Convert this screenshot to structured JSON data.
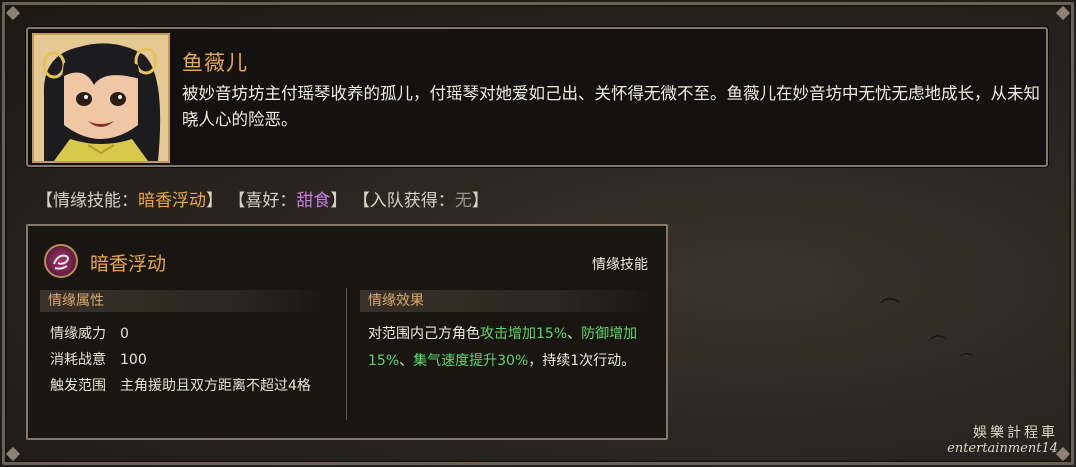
{
  "character": {
    "name": "鱼薇儿",
    "description": "被妙音坊坊主付瑶琴收养的孤儿，付瑶琴对她爱如己出、关怀得无微不至。鱼薇儿在妙音坊中无忧无虑地成长，从未知晓人心的险恶。"
  },
  "tags": {
    "skill_label": "【情缘技能：",
    "skill_value": "暗香浮动",
    "close1": "】",
    "hobby_label": "【喜好：",
    "hobby_value": "甜食",
    "close2": "】",
    "join_label": "【入队获得：",
    "join_value": "无",
    "close3": "】"
  },
  "skill": {
    "name": "暗香浮动",
    "type": "情缘技能",
    "attributes_header": "情缘属性",
    "effects_header": "情缘效果",
    "attributes": [
      {
        "label": "情缘威力",
        "value": "0"
      },
      {
        "label": "消耗战意",
        "value": "100"
      },
      {
        "label": "触发范围",
        "value": "主角援助且双方距离不超过4格"
      }
    ],
    "effect": {
      "p1": "对范围内己方角色",
      "g1": "攻击增加15%",
      "p2": "、",
      "g2": "防御增加15%",
      "p3": "、",
      "g3": "集气速度提升30%",
      "p4": "，持续1次行动。"
    }
  },
  "watermark": {
    "cn": "娛樂計程車",
    "en": "entertainment14"
  },
  "colors": {
    "accent_orange": "#e8a847",
    "hobby_purple": "#c57cd8",
    "buff_green": "#5ed66a",
    "frame": "#84786a"
  },
  "icons": {
    "skill": "swirl-skill-icon",
    "portrait": "character-portrait"
  }
}
